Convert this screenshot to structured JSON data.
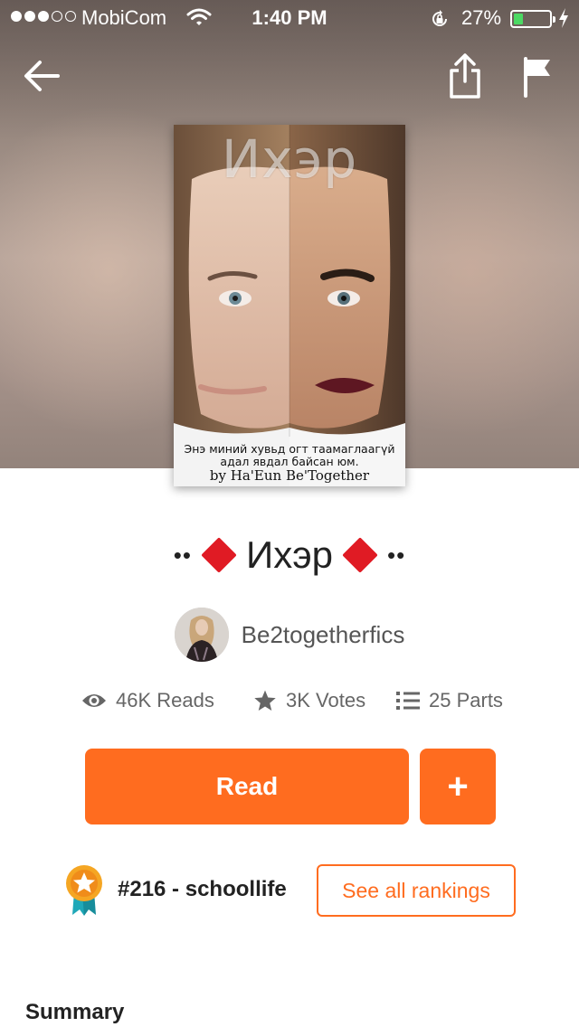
{
  "status_bar": {
    "carrier": "MobiCom",
    "time": "1:40 PM",
    "battery_percent": "27%",
    "battery_level": 0.27,
    "signal_bars_filled": 3,
    "signal_bars_total": 5
  },
  "nav": {
    "back_icon": "arrow-left-icon",
    "share_icon": "share-icon",
    "flag_icon": "flag-icon"
  },
  "cover": {
    "title": "Ихэр",
    "caption": "Энэ миний хувьд огт таамаглаагүй адал явдал байсан юм.",
    "author_line": "by Ha'Eun Be'Together"
  },
  "story": {
    "title": "Ихэр",
    "title_prefix": "••",
    "title_suffix": "••"
  },
  "author": {
    "name": "Be2togetherfics"
  },
  "stats": {
    "reads": "46K Reads",
    "votes": "3K Votes",
    "parts": "25 Parts"
  },
  "actions": {
    "read_label": "Read",
    "add_label": "+"
  },
  "ranking": {
    "text": "#216 - schoollife",
    "see_all_label": "See all rankings"
  },
  "summary": {
    "heading": "Summary"
  },
  "colors": {
    "accent": "#ff6c1f",
    "diamond": "#e01b24",
    "badge_gold": "#f5a623",
    "badge_ribbon": "#1fa8b8"
  }
}
